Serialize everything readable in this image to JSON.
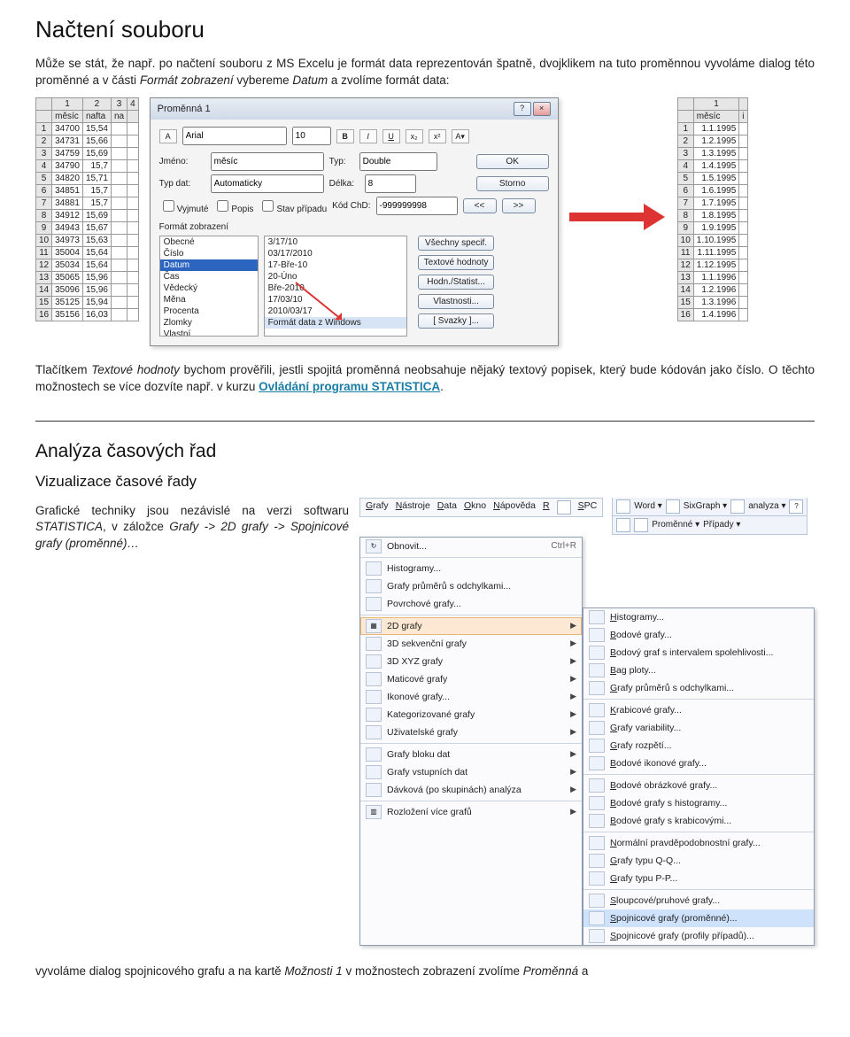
{
  "title": "Načtení souboru",
  "para1_a": "Může se stát, že např. po načtení souboru z MS Excelu je formát data reprezentován špatně, dvojklikem na tuto proměnnou vyvoláme dialog této proměnné a v části ",
  "para1_b": "Formát zobrazení",
  "para1_c": " vybereme ",
  "para1_d": "Datum",
  "para1_e": " a zvolíme formát data:",
  "sheetA": {
    "cols": [
      "1",
      "2",
      "3",
      "4"
    ],
    "head2": [
      "",
      "měsíc",
      "nafta",
      "na"
    ],
    "rows": [
      [
        "1",
        "34700",
        "15,54",
        ""
      ],
      [
        "2",
        "34731",
        "15,66",
        ""
      ],
      [
        "3",
        "34759",
        "15,69",
        ""
      ],
      [
        "4",
        "34790",
        "15,7",
        ""
      ],
      [
        "5",
        "34820",
        "15,71",
        ""
      ],
      [
        "6",
        "34851",
        "15,7",
        ""
      ],
      [
        "7",
        "34881",
        "15,7",
        ""
      ],
      [
        "8",
        "34912",
        "15,69",
        ""
      ],
      [
        "9",
        "34943",
        "15,67",
        ""
      ],
      [
        "10",
        "34973",
        "15,63",
        ""
      ],
      [
        "11",
        "35004",
        "15,64",
        ""
      ],
      [
        "12",
        "35034",
        "15,64",
        ""
      ],
      [
        "13",
        "35065",
        "15,96",
        ""
      ],
      [
        "14",
        "35096",
        "15,96",
        ""
      ],
      [
        "15",
        "35125",
        "15,94",
        ""
      ],
      [
        "16",
        "35156",
        "16,03",
        ""
      ]
    ]
  },
  "dialog": {
    "title": "Proměnná 1",
    "font": "Arial",
    "size": "10",
    "tb_b": "B",
    "tb_i": "I",
    "tb_u": "U",
    "name_label": "Jméno:",
    "name_val": "měsíc",
    "type_label": "Typ:",
    "type_val": "Double",
    "ok": "OK",
    "datatype_label": "Typ dat:",
    "datatype_val": "Automaticky",
    "len_label": "Délka:",
    "len_val": "8",
    "storno": "Storno",
    "chk_vyjmute": "Vyjmuté",
    "chk_popis": "Popis",
    "chk_stav": "Stav případu",
    "kod_label": "Kód ChD:",
    "kod_val": "-999999998",
    "section_label": "Formát zobrazení",
    "list": [
      "Obecné",
      "Číslo",
      "Datum",
      "Čas",
      "Vědecký",
      "Měna",
      "Procenta",
      "Zlomky",
      "Vlastní"
    ],
    "list_sel": 2,
    "formats": [
      "3/17/10",
      "03/17/2010",
      "17-Bře-10",
      "20-Úno",
      "Bře-2010",
      "17/03/10",
      "2010/03/17",
      "Formát data z Windows"
    ],
    "formats_sel": 7,
    "btn_all": "Všechny specif.",
    "btn_text": "Textové hodnoty",
    "btn_hodn": "Hodn./Statist...",
    "btn_vlast": "Vlastnosti...",
    "btn_svaz": "[ Svazky ]..."
  },
  "sheetB": {
    "cols": [
      "1"
    ],
    "head2": [
      "",
      "měsíc",
      "i"
    ],
    "rows": [
      [
        "1",
        "1.1.1995"
      ],
      [
        "2",
        "1.2.1995"
      ],
      [
        "3",
        "1.3.1995"
      ],
      [
        "4",
        "1.4.1995"
      ],
      [
        "5",
        "1.5.1995"
      ],
      [
        "6",
        "1.6.1995"
      ],
      [
        "7",
        "1.7.1995"
      ],
      [
        "8",
        "1.8.1995"
      ],
      [
        "9",
        "1.9.1995"
      ],
      [
        "10",
        "1.10.1995"
      ],
      [
        "11",
        "1.11.1995"
      ],
      [
        "12",
        "1.12.1995"
      ],
      [
        "13",
        "1.1.1996"
      ],
      [
        "14",
        "1.2.1996"
      ],
      [
        "15",
        "1.3.1996"
      ],
      [
        "16",
        "1.4.1996"
      ]
    ]
  },
  "para2_a": "Tlačítkem ",
  "para2_b": "Textové hodnoty",
  "para2_c": " bychom prověřili, jestli spojitá proměnná neobsahuje nějaký textový popisek, který bude kódován jako číslo. O těchto možnostech se více dozvíte např. v kurzu ",
  "para2_linktext": "Ovládání programu STATISTICA",
  "para2_d": ".",
  "h2": "Analýza časových řad",
  "h3": "Vizualizace časové řady",
  "para3_a": "Grafické techniky jsou nezávislé na verzi softwaru ",
  "para3_b": "STATISTICA",
  "para3_c": ", v záložce ",
  "para3_d": "Grafy -> 2D grafy -> Spojnicové grafy (proměnné)…",
  "menubar": [
    "Grafy",
    "Nástroje",
    "Data",
    "Okno",
    "Nápověda",
    "R",
    "SPC"
  ],
  "toolbarA_items": [
    "Word",
    "SixGraph",
    "analyza"
  ],
  "toolbarB_items": [
    "Proměnné",
    "Případy"
  ],
  "menu_top": {
    "label": "Obnovit...",
    "shortcut": "Ctrl+R"
  },
  "menu_items": [
    "Histogramy...",
    "Grafy průměrů s odchylkami...",
    "Povrchové grafy..."
  ],
  "menu_2d": "2D grafy",
  "menu_more": [
    "3D sekvenční grafy",
    "3D XYZ grafy",
    "Maticové grafy",
    "Ikonové grafy...",
    "Kategorizované grafy",
    "Uživatelské grafy"
  ],
  "menu_more2": [
    "Grafy bloku dat",
    "Grafy vstupních dat",
    "Dávková (po skupinách) analýza"
  ],
  "menu_last": "Rozložení více grafů",
  "submenu_items": [
    "Histogramy...",
    "Bodové grafy...",
    "Bodový graf s intervalem spolehlivosti...",
    "Bag ploty...",
    "Grafy průměrů s odchylkami...",
    "Krabicové grafy...",
    "Grafy variability...",
    "Grafy rozpětí...",
    "Bodové ikonové grafy...",
    "Bodové obrázkové grafy...",
    "Bodové grafy s histogramy...",
    "Bodové grafy s krabicovými...",
    "Normální pravděpodobnostní grafy...",
    "Grafy typu Q-Q...",
    "Grafy typu P-P...",
    "Sloupcové/pruhové grafy...",
    "Spojnicové grafy (proměnné)...",
    "Spojnicové grafy (profily případů)..."
  ],
  "submenu_sel": 16,
  "footer_a": "vyvoláme dialog spojnicového grafu a na kartě ",
  "footer_b": "Možnosti 1",
  "footer_c": " v možnostech zobrazení zvolíme ",
  "footer_d": "Proměnná",
  "footer_e": " a"
}
